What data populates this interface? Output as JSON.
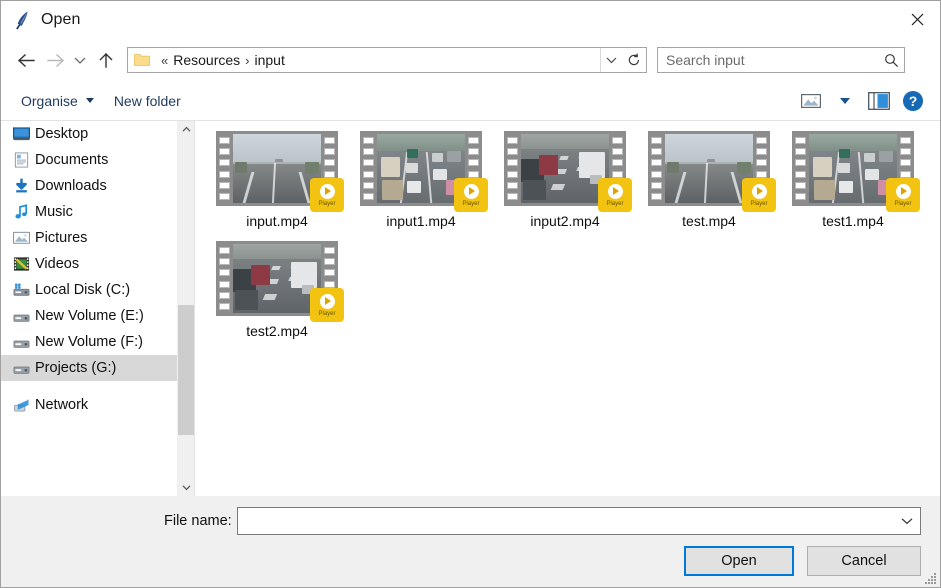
{
  "window": {
    "title": "Open",
    "icon": "feather-icon",
    "close_label": "✕"
  },
  "navigation": {
    "back_icon": "arrow-left-icon",
    "forward_icon": "arrow-right-icon",
    "recent_icon": "chevron-down-icon",
    "up_icon": "arrow-up-icon",
    "folder_icon": "folder-icon",
    "breadcrumb_prefix": "«",
    "breadcrumbs": [
      "Resources",
      "input"
    ],
    "breadcrumb_separator": "›",
    "address_dropdown_icon": "chevron-down-icon",
    "refresh_icon": "refresh-icon"
  },
  "search": {
    "placeholder": "Search input",
    "value": "",
    "icon": "search-icon"
  },
  "command_bar": {
    "organise_label": "Organise",
    "organise_caret_icon": "caret-down-icon",
    "new_folder_label": "New folder",
    "view_icon": "view-options-icon",
    "view_caret_icon": "caret-down-icon",
    "preview_pane_icon": "preview-pane-icon",
    "help_icon": "help-icon"
  },
  "sidebar": {
    "items": [
      {
        "label": "Desktop",
        "icon": "desktop-icon",
        "selected": false
      },
      {
        "label": "Documents",
        "icon": "documents-icon",
        "selected": false
      },
      {
        "label": "Downloads",
        "icon": "downloads-icon",
        "selected": false
      },
      {
        "label": "Music",
        "icon": "music-icon",
        "selected": false
      },
      {
        "label": "Pictures",
        "icon": "pictures-icon",
        "selected": false
      },
      {
        "label": "Videos",
        "icon": "videos-icon",
        "selected": false
      },
      {
        "label": "Local Disk (C:)",
        "icon": "drive-system-icon",
        "selected": false
      },
      {
        "label": "New Volume (E:)",
        "icon": "drive-icon",
        "selected": false
      },
      {
        "label": "New Volume (F:)",
        "icon": "drive-icon",
        "selected": false
      },
      {
        "label": "Projects (G:)",
        "icon": "drive-icon",
        "selected": true
      },
      {
        "label": "Network",
        "icon": "network-icon",
        "selected": false
      }
    ],
    "scroll_up_icon": "chevron-up-icon",
    "scroll_down_icon": "chevron-down-icon"
  },
  "files": [
    {
      "name": "input.mp4",
      "type": "video",
      "badge": "Player",
      "scene": "highway-empty"
    },
    {
      "name": "input1.mp4",
      "type": "video",
      "badge": "Player",
      "scene": "city-traffic"
    },
    {
      "name": "input2.mp4",
      "type": "video",
      "badge": "Player",
      "scene": "street-cars"
    },
    {
      "name": "test.mp4",
      "type": "video",
      "badge": "Player",
      "scene": "highway-empty"
    },
    {
      "name": "test1.mp4",
      "type": "video",
      "badge": "Player",
      "scene": "city-traffic"
    },
    {
      "name": "test2.mp4",
      "type": "video",
      "badge": "Player",
      "scene": "street-cars"
    }
  ],
  "footer": {
    "filename_label": "File name:",
    "filename_value": "",
    "filename_placeholder": "",
    "filename_caret_icon": "chevron-down-icon",
    "open_label": "Open",
    "cancel_label": "Cancel",
    "resize_grip_icon": "resize-grip-icon"
  },
  "colors": {
    "accent": "#0078d7",
    "selection": "#d8d8d8",
    "badge": "#f2c310",
    "chrome": "#f0f0f0",
    "link_text": "#1f3a5f"
  }
}
